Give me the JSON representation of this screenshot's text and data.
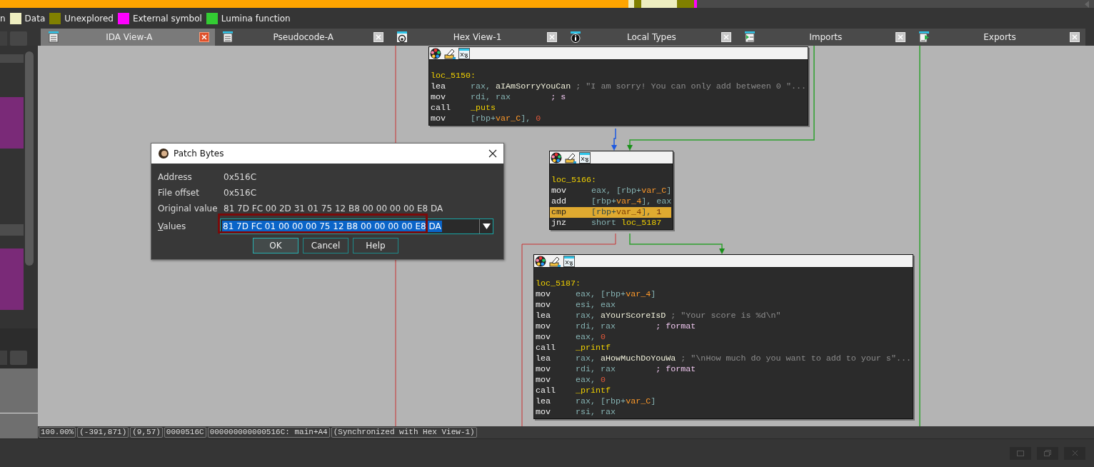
{
  "legend": [
    {
      "label": "n"
    },
    {
      "label": "Data",
      "color": "#eeeec0"
    },
    {
      "label": "Unexplored",
      "color": "#808000"
    },
    {
      "label": "External symbol",
      "color": "#ff00ff"
    },
    {
      "label": "Lumina function",
      "color": "#33cc33"
    }
  ],
  "tabs": [
    {
      "label": "IDA View-A",
      "kind": "disassembly",
      "selected": true
    },
    {
      "label": "Pseudocode-A",
      "kind": "pseudocode",
      "selected": false
    },
    {
      "label": "Hex View-1",
      "kind": "hex",
      "selected": false
    },
    {
      "label": "Local Types",
      "kind": "types",
      "selected": false
    },
    {
      "label": "Imports",
      "kind": "imports",
      "selected": false
    },
    {
      "label": "Exports",
      "kind": "exports",
      "selected": false
    }
  ],
  "graph_nodes": [
    {
      "lines": [
        {
          "label": "loc_5150:"
        },
        {
          "mnemonic": "lea",
          "tokens": [
            {
              "kind": "reg",
              "text": "rax, "
            },
            {
              "kind": "name",
              "text": "aIAmSorryYouCan"
            },
            {
              "kind": "comment",
              "text": " ; \"I am sorry! You can only add between 0 \"..."
            }
          ]
        },
        {
          "mnemonic": "mov",
          "tokens": [
            {
              "kind": "reg",
              "text": "rdi, rax"
            },
            {
              "kind": "hint",
              "text": "        ; s"
            }
          ]
        },
        {
          "mnemonic": "call",
          "tokens": [
            {
              "kind": "func",
              "text": "_puts"
            }
          ]
        },
        {
          "mnemonic": "mov",
          "tokens": [
            {
              "kind": "reg",
              "text": "[rbp+"
            },
            {
              "kind": "var",
              "text": "var_C"
            },
            {
              "kind": "reg",
              "text": "], "
            },
            {
              "kind": "num",
              "text": "0"
            }
          ]
        }
      ]
    },
    {
      "lines": [
        {
          "label": "loc_5166:"
        },
        {
          "mnemonic": "mov",
          "tokens": [
            {
              "kind": "reg",
              "text": "eax, [rbp+"
            },
            {
              "kind": "var",
              "text": "var_C"
            },
            {
              "kind": "reg",
              "text": "]"
            }
          ]
        },
        {
          "mnemonic": "add",
          "tokens": [
            {
              "kind": "reg",
              "text": "[rbp+"
            },
            {
              "kind": "var",
              "text": "var_4"
            },
            {
              "kind": "reg",
              "text": "], eax"
            }
          ]
        },
        {
          "mnemonic": "cmp",
          "highlighted": true,
          "tokens": [
            {
              "kind": "reg",
              "text": "[rbp+"
            },
            {
              "kind": "var",
              "text": "var_4"
            },
            {
              "kind": "reg",
              "text": "], "
            },
            {
              "kind": "num",
              "text": "1"
            }
          ]
        },
        {
          "mnemonic": "jnz",
          "tokens": [
            {
              "kind": "reg",
              "text": "short "
            },
            {
              "kind": "func",
              "text": "loc_5187"
            }
          ]
        }
      ]
    },
    {
      "lines": [
        {
          "label": "loc_5187:"
        },
        {
          "mnemonic": "mov",
          "tokens": [
            {
              "kind": "reg",
              "text": "eax, [rbp+"
            },
            {
              "kind": "var",
              "text": "var_4"
            },
            {
              "kind": "reg",
              "text": "]"
            }
          ]
        },
        {
          "mnemonic": "mov",
          "tokens": [
            {
              "kind": "reg",
              "text": "esi, eax"
            }
          ]
        },
        {
          "mnemonic": "lea",
          "tokens": [
            {
              "kind": "reg",
              "text": "rax, "
            },
            {
              "kind": "name",
              "text": "aYourScoreIsD"
            },
            {
              "kind": "comment",
              "text": " ; \"Your score is %d\\n\""
            }
          ]
        },
        {
          "mnemonic": "mov",
          "tokens": [
            {
              "kind": "reg",
              "text": "rdi, rax"
            },
            {
              "kind": "hint",
              "text": "        ; format"
            }
          ]
        },
        {
          "mnemonic": "mov",
          "tokens": [
            {
              "kind": "reg",
              "text": "eax, "
            },
            {
              "kind": "num",
              "text": "0"
            }
          ]
        },
        {
          "mnemonic": "call",
          "tokens": [
            {
              "kind": "func",
              "text": "_printf"
            }
          ]
        },
        {
          "mnemonic": "lea",
          "tokens": [
            {
              "kind": "reg",
              "text": "rax, "
            },
            {
              "kind": "name",
              "text": "aHowMuchDoYouWa"
            },
            {
              "kind": "comment",
              "text": " ; \"\\nHow much do you want to add to your s\"..."
            }
          ]
        },
        {
          "mnemonic": "mov",
          "tokens": [
            {
              "kind": "reg",
              "text": "rdi, rax"
            },
            {
              "kind": "hint",
              "text": "        ; format"
            }
          ]
        },
        {
          "mnemonic": "mov",
          "tokens": [
            {
              "kind": "reg",
              "text": "eax, "
            },
            {
              "kind": "num",
              "text": "0"
            }
          ]
        },
        {
          "mnemonic": "call",
          "tokens": [
            {
              "kind": "func",
              "text": "_printf"
            }
          ]
        },
        {
          "mnemonic": "lea",
          "tokens": [
            {
              "kind": "reg",
              "text": "rax, [rbp+"
            },
            {
              "kind": "var",
              "text": "var_C"
            },
            {
              "kind": "reg",
              "text": "]"
            }
          ]
        },
        {
          "mnemonic": "mov",
          "tokens": [
            {
              "kind": "reg",
              "text": "rsi, rax"
            }
          ]
        }
      ]
    }
  ],
  "dialog": {
    "title": "Patch Bytes",
    "fields": [
      {
        "label": "Address",
        "value": "0x516C"
      },
      {
        "label": "File offset",
        "value": "0x516C"
      },
      {
        "label": "Original value",
        "value": "81 7D FC 00 2D 31 01 75 12 B8 00 00 00 00 E8 DA"
      }
    ],
    "values": {
      "label": "Values",
      "value": "81 7D FC 01 00 00 00 75 12 B8 00 00 00 00 E8 DA"
    },
    "buttons": [
      {
        "label": "OK",
        "default": true
      },
      {
        "label": "Cancel",
        "default": false
      },
      {
        "label": "Help",
        "default": false
      }
    ]
  },
  "status_bar": [
    "100.00%",
    "(-391,871)",
    "(9,57)",
    "0000516C",
    "000000000000516C: main+A4",
    "(Synchronized with Hex View-1)"
  ]
}
